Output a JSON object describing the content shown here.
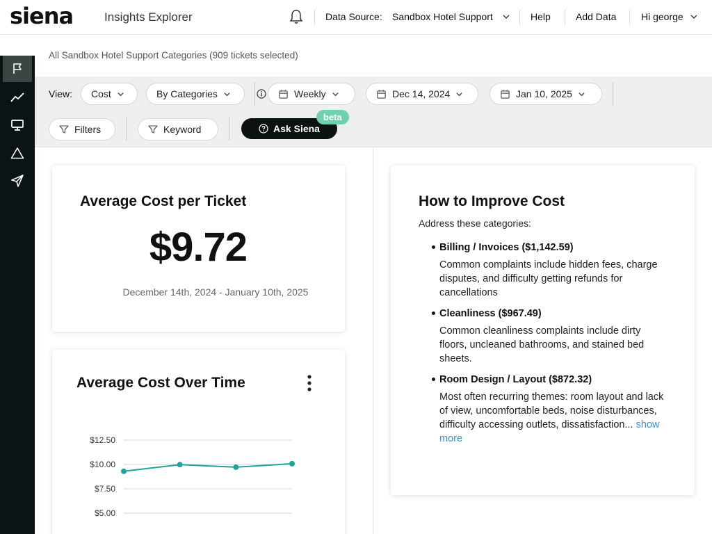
{
  "header": {
    "logo": "siena",
    "app_title": "Insights Explorer",
    "data_source_label": "Data Source:",
    "data_source_value": "Sandbox Hotel Support",
    "help": "Help",
    "add_data": "Add Data",
    "user_greeting": "Hi george"
  },
  "breadcrumb": "All Sandbox Hotel Support Categories (909 tickets selected)",
  "filters": {
    "view_label": "View:",
    "metric": "Cost",
    "grouping": "By Categories",
    "interval": "Weekly",
    "start_date": "Dec 14, 2024",
    "end_date": "Jan 10, 2025",
    "filters_btn": "Filters",
    "keyword_btn": "Keyword",
    "ask_btn": "Ask Siena",
    "beta_badge": "beta"
  },
  "kpi": {
    "title": "Average Cost per Ticket",
    "value": "$9.72",
    "range": "December 14th, 2024 - January 10th, 2025"
  },
  "trend": {
    "title": "Average Cost Over Time"
  },
  "chart_data": {
    "type": "line",
    "title": "Average Cost Over Time",
    "y_ticks": [
      "$12.50",
      "$10.00",
      "$7.50",
      "$5.00"
    ],
    "ylim": [
      5.0,
      12.5
    ],
    "x": [
      1,
      2,
      3,
      4
    ],
    "series": [
      {
        "values": [
          9.3,
          9.98,
          9.72,
          10.08
        ]
      }
    ],
    "line_color": "#1fa39a",
    "grid": true
  },
  "improve": {
    "title": "How to Improve Cost",
    "subtitle": "Address these categories:",
    "items": [
      {
        "heading": "Billing / Invoices ($1,142.59)",
        "desc": "Common complaints include hidden fees, charge disputes, and difficulty getting refunds for cancellations"
      },
      {
        "heading": "Cleanliness ($967.49)",
        "desc": "Common cleanliness complaints include dirty floors, uncleaned bathrooms, and stained bed sheets."
      },
      {
        "heading": "Room Design / Layout ($872.32)",
        "desc": "Most often recurring themes: room layout and lack of view, uncomfortable beds, noise disturbances, difficulty accessing outlets, dissatisfaction...",
        "more": "show more"
      }
    ]
  },
  "colors": {
    "accent": "#1fa39a",
    "beta": "#6fd1b0",
    "sidebar": "#0b1414",
    "link": "#3b8fd8"
  }
}
